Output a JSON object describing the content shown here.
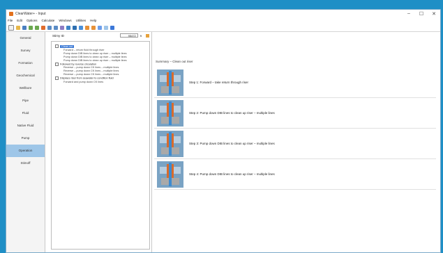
{
  "window": {
    "title": "ClearWater+ - Input",
    "minimize": "–",
    "maximize": "☐",
    "close": "✕"
  },
  "menu": [
    "File",
    "Edit",
    "Options",
    "Calculate",
    "Windows",
    "Utilities",
    "Help"
  ],
  "sidebar": [
    "General",
    "Survey",
    "Formation",
    "Geochemical",
    "Wellbore",
    "Pipe",
    "Fluid",
    "Native Fluid",
    "Pump",
    "Operation",
    "Stimoff"
  ],
  "sidebar_active": "Operation",
  "tree_header": {
    "label": "Stimy ID",
    "value": "95472",
    "unit": "ft"
  },
  "tree": [
    {
      "level": 0,
      "text": "Clean out",
      "selected": true
    },
    {
      "level": 1,
      "text": "Forward – return fluid through riser"
    },
    {
      "level": 1,
      "text": "Pump down DIB lines to clean up riser – multiple lines"
    },
    {
      "level": 1,
      "text": "Pump down DIB lines to clean up riser – multiple lines"
    },
    {
      "level": 1,
      "text": "Pump down DIB lines to clean up riser – multiple lines"
    },
    {
      "level": 0,
      "text": "Followed by reverse circulation"
    },
    {
      "level": 1,
      "text": "Reverse – pump down CK lines – multiple lines"
    },
    {
      "level": 1,
      "text": "Reverse – pump down CK lines – multiple lines"
    },
    {
      "level": 1,
      "text": "Reverse – pump down CK lines – multiple lines"
    },
    {
      "level": 0,
      "text": "Displace riser from seawater to condition fluid"
    },
    {
      "level": 1,
      "text": "Forward and pump down CK lines"
    }
  ],
  "summary": {
    "title": "Summary – Clean out riser",
    "steps": [
      "Step 1: Forward – take return through riser",
      "Step 2: Pump down DIB lines to clean up riser – multiple lines",
      "Step 3: Pump down DIB lines to clean up riser – multiple lines",
      "Step 4: Pump down DIB lines to clean up riser – multiple lines"
    ]
  }
}
